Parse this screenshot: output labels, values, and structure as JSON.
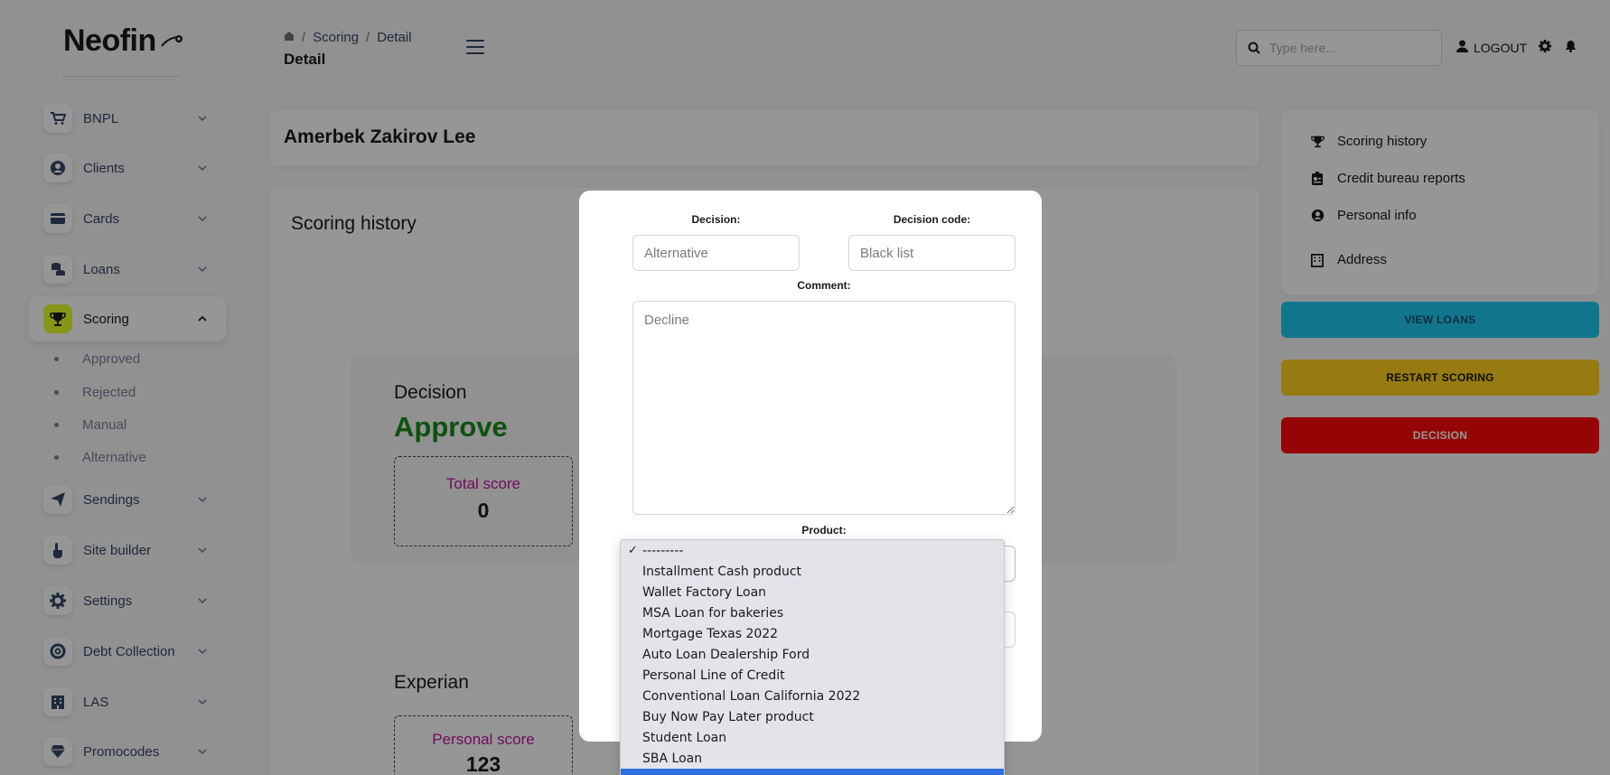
{
  "brand": {
    "name": "Neofin"
  },
  "sidebar": {
    "items": [
      {
        "label": "BNPL",
        "icon": "cart-icon"
      },
      {
        "label": "Clients",
        "icon": "user-circle-icon"
      },
      {
        "label": "Cards",
        "icon": "card-icon"
      },
      {
        "label": "Loans",
        "icon": "coins-icon"
      },
      {
        "label": "Scoring",
        "icon": "trophy-icon",
        "active": true
      },
      {
        "label": "Sendings",
        "icon": "paper-plane-icon"
      },
      {
        "label": "Site builder",
        "icon": "hand-pointer-icon"
      },
      {
        "label": "Settings",
        "icon": "gear-icon"
      },
      {
        "label": "Debt Collection",
        "icon": "lifebuoy-icon"
      },
      {
        "label": "LAS",
        "icon": "building-icon"
      },
      {
        "label": "Promocodes",
        "icon": "gem-icon"
      }
    ],
    "scoring_sub": [
      "Approved",
      "Rejected",
      "Manual",
      "Alternative"
    ]
  },
  "header": {
    "breadcrumb": [
      "Scoring",
      "Detail"
    ],
    "title": "Detail",
    "search_placeholder": "Type here...",
    "logout_label": "LOGOUT"
  },
  "client": {
    "name": "Amerbek Zakirov Lee"
  },
  "history": {
    "title": "Scoring history",
    "decision_label": "Decision",
    "decision_value": "Approve",
    "total_score_label": "Total score",
    "total_score_value": "0",
    "experian_title": "Experian",
    "personal_score_label": "Personal score",
    "personal_score_value": "123"
  },
  "right_panel": {
    "links": [
      {
        "label": "Scoring history",
        "icon": "trophy-icon"
      },
      {
        "label": "Credit bureau reports",
        "icon": "id-card-icon"
      },
      {
        "label": "Personal info",
        "icon": "user-circle-icon"
      },
      {
        "label": "Address",
        "icon": "building-icon"
      }
    ],
    "buttons": {
      "view_loans": "VIEW LOANS",
      "restart_scoring": "RESTART SCORING",
      "decision": "DECISION"
    }
  },
  "modal": {
    "decision_label": "Decision:",
    "decision_placeholder": "Alternative",
    "decision_code_label": "Decision code:",
    "decision_code_placeholder": "Black list",
    "comment_label": "Comment:",
    "comment_placeholder": "Decline",
    "product_label": "Product:",
    "product_options": [
      "---------",
      "Installment Cash product",
      "Wallet Factory Loan",
      "MSA Loan for bakeries",
      "Mortgage Texas 2022",
      "Auto Loan Dealership Ford",
      "Personal Line of Credit",
      "Conventional Loan California 2022",
      "Buy Now Pay Later product",
      "Student Loan",
      "SBA Loan"
    ],
    "product_selected": "---------"
  },
  "colors": {
    "accent_yellow": "#e5ff2d",
    "approve_green": "#1a8a1a",
    "score_magenta": "#c0169b",
    "btn_view": "#1ec9ef",
    "btn_restart": "#ffcf1f",
    "btn_decision": "#ff0a0a"
  }
}
